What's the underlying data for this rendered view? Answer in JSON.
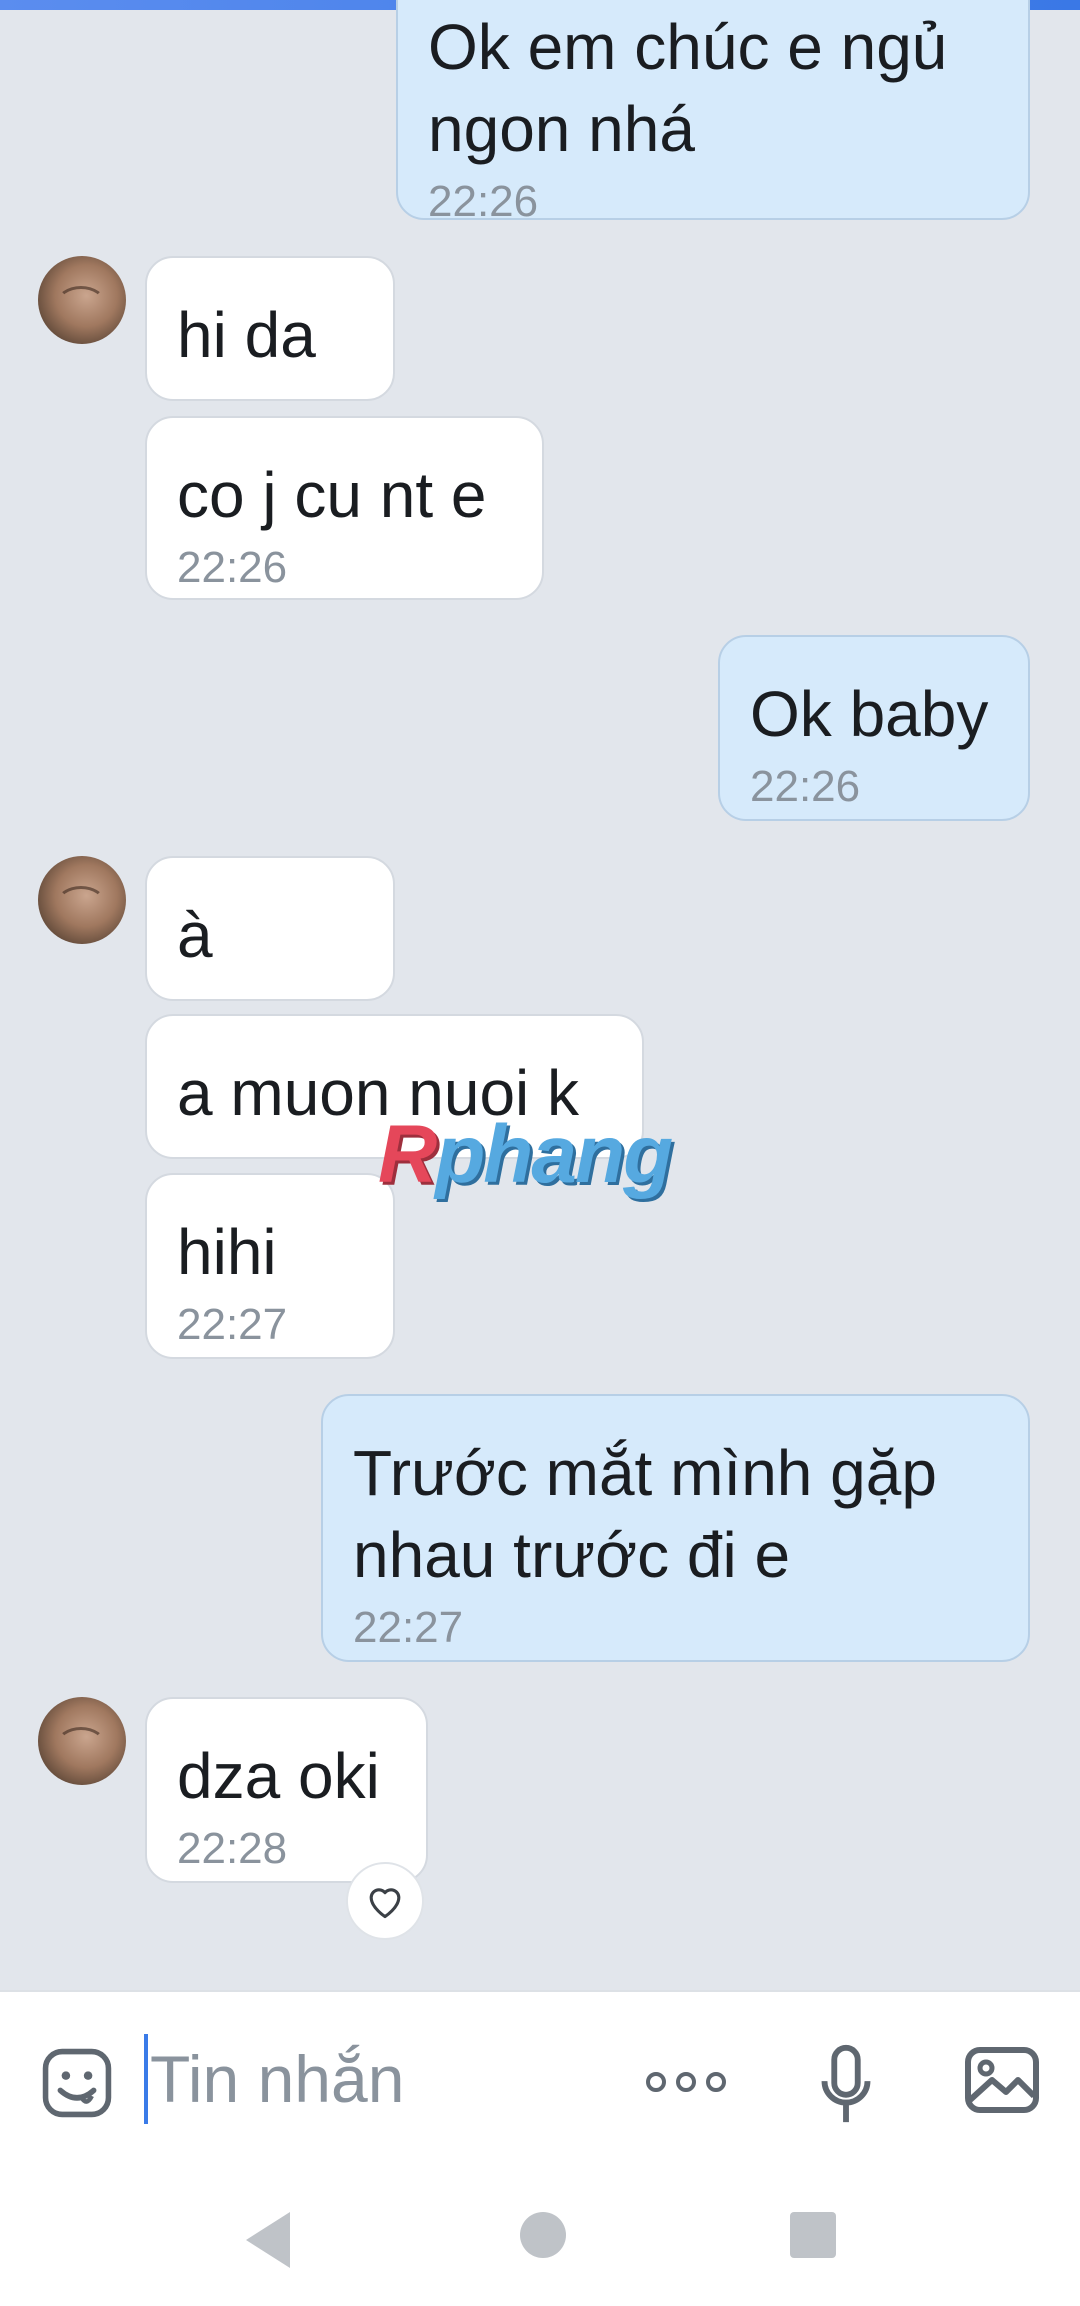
{
  "messages": [
    {
      "side": "out",
      "text": "Ok em chúc e ngủ ngon nhá",
      "time": "22:26"
    },
    {
      "side": "in",
      "text": "hi da",
      "time": ""
    },
    {
      "side": "in",
      "text": "co j cu nt e",
      "time": "22:26"
    },
    {
      "side": "out",
      "text": "Ok baby",
      "time": "22:26"
    },
    {
      "side": "in",
      "text": "à",
      "time": ""
    },
    {
      "side": "in",
      "text": "a muon nuoi k",
      "time": ""
    },
    {
      "side": "in",
      "text": "hihi",
      "time": "22:27"
    },
    {
      "side": "out",
      "text": "Trước mắt mình gặp nhau trước đi e",
      "time": "22:27"
    },
    {
      "side": "in",
      "text": "dza oki",
      "time": "22:28"
    }
  ],
  "watermark": {
    "first": "R",
    "rest": "phang"
  },
  "composer": {
    "placeholder": "Tin nhắn"
  },
  "icons": {
    "emoji": "emoji-icon",
    "more": "more-dots-icon",
    "mic": "microphone-icon",
    "gallery": "gallery-icon",
    "heart": "heart-icon"
  },
  "colors": {
    "incoming": "#ffffff",
    "outgoing": "#d6eafb",
    "background": "#e2e6ec",
    "accent": "#3a7be8"
  }
}
